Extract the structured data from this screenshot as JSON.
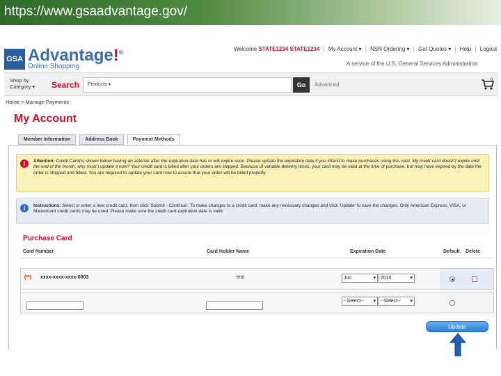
{
  "url": "https://www.gsaadvantage.gov/",
  "header": {
    "logo_text": "GSA",
    "brand": "Advantage",
    "brand_mark": "!",
    "brand_reg": "®",
    "brand_sub": "Online Shopping",
    "welcome": "Welcome",
    "user": "STATE1234 STATE1234",
    "nav": [
      "My Account",
      "NSN Ordering",
      "Get Quotes",
      "Help",
      "Logout"
    ],
    "tagline": "A service of the U.S. General Services Administration"
  },
  "search": {
    "shop_by": "Shop by",
    "category": "Category",
    "label": "Search",
    "products": "Products",
    "go": "Go",
    "advanced": "Advanced",
    "cart_count": "0"
  },
  "breadcrumb": "Home > Manage Payments",
  "page_title": "My Account",
  "tabs": [
    {
      "label": "Member Information"
    },
    {
      "label": "Address Book"
    },
    {
      "label": "Payment Methods"
    }
  ],
  "attention": {
    "lead": "Attention:",
    "text": "Credit Card(s) shown below having an asterisk after the expiration date has or will expire soon. Please update the expiration date if you intend to make purchases using this card.",
    "question": "My credit card doesn't expire until the end of the month, why must I update it now?",
    "text2": "Your credit card is billed after your orders are shipped. Because of variable delivery times, your card may be valid at the time of purchase, but may have expired by the date the order is shipped and billed. You are required to update your card now to assure that your order will be billed properly."
  },
  "instructions": {
    "lead": "Instructions:",
    "text": "Select or enter a new credit card, then click 'Submit - Continue'. To make changes to a credit card, make any necessary changes and click 'Update' to save the changes. Only American Express, VISA, or Mastercard credit cards may be used. Please make sure the credit card expiration date is valid."
  },
  "purchase_card": {
    "title": "Purchase Card",
    "columns": [
      "Card Number",
      "Card Holder Name",
      "Expiration Date",
      "Default",
      "Delete"
    ],
    "rows": [
      {
        "card_prefix": "(**)",
        "card_number": "xxxx-xxxx-xxxx-0003",
        "holder": "test",
        "month": "Jun",
        "year": "2010"
      },
      {
        "card_prefix": "",
        "card_number": "",
        "holder": "",
        "month": "--Select--",
        "year": "--Select--"
      }
    ],
    "update_label": "Update"
  },
  "colors": {
    "accent_red": "#c8102e",
    "brand_blue": "#3a6ea5",
    "update_blue": "#2a7fd4"
  }
}
